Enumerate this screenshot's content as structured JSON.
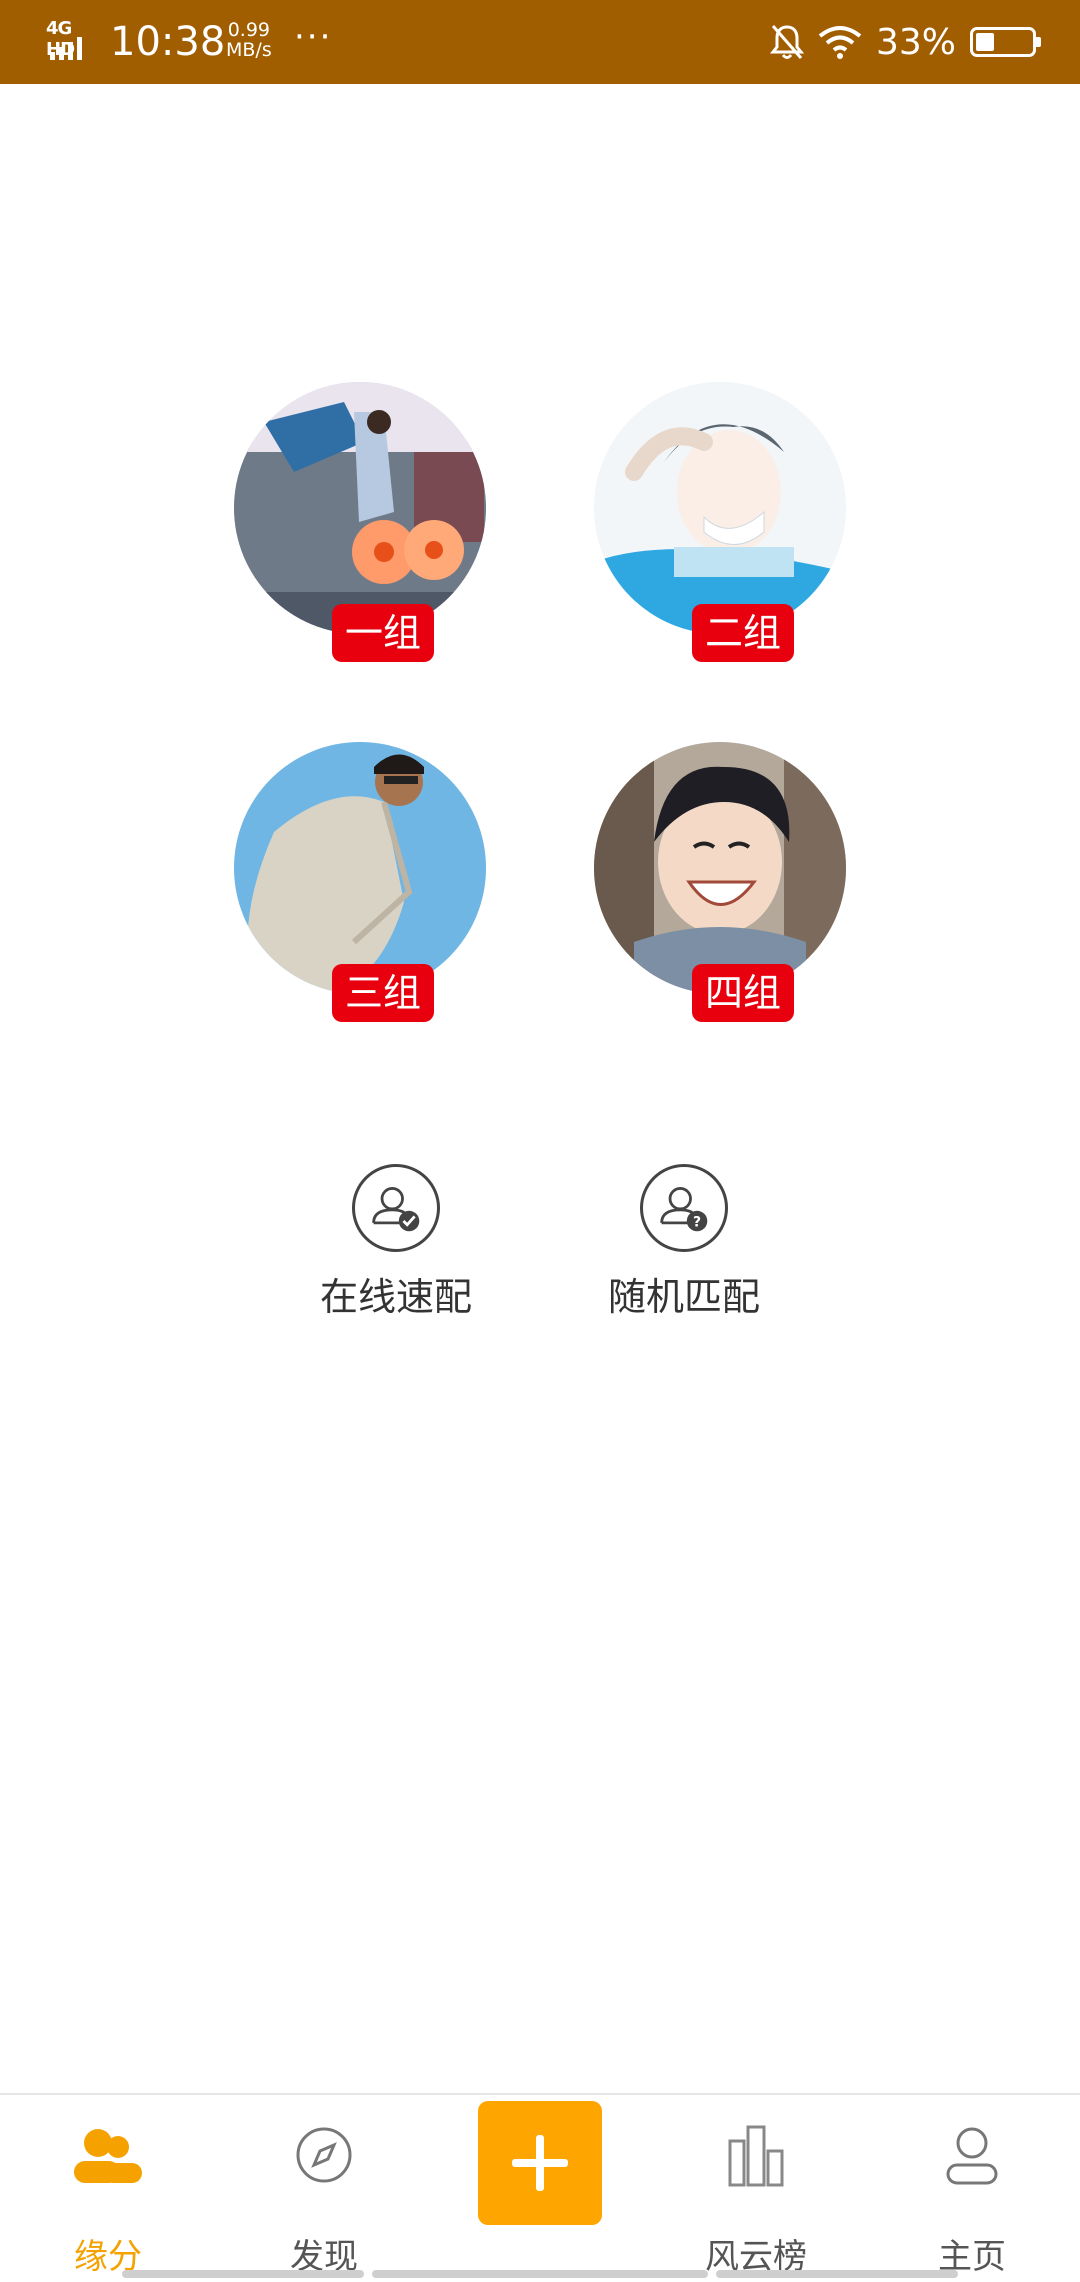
{
  "status_bar": {
    "network": "4G HD",
    "time": "10:38",
    "speed_value": "0.99",
    "speed_unit": "MB/s",
    "more": "···",
    "battery_percent": "33%",
    "battery_level": 0.33,
    "icons": [
      "bell-off-icon",
      "wifi-icon",
      "battery-icon"
    ]
  },
  "groups": [
    {
      "label": "一组",
      "avatar": "avatar-photo-girl-on-boat"
    },
    {
      "label": "二组",
      "avatar": "avatar-anime-boy"
    },
    {
      "label": "三组",
      "avatar": "avatar-photo-man-jacket"
    },
    {
      "label": "四组",
      "avatar": "avatar-photo-boy-smiling"
    }
  ],
  "actions": [
    {
      "label": "在线速配",
      "icon": "user-check-icon"
    },
    {
      "label": "随机匹配",
      "icon": "user-question-icon"
    }
  ],
  "bottom_nav": {
    "items": [
      {
        "label": "缘分",
        "icon": "users-icon",
        "active": true
      },
      {
        "label": "发现",
        "icon": "compass-icon",
        "active": false
      },
      {
        "label": "风云榜",
        "icon": "ranking-icon",
        "active": false
      },
      {
        "label": "主页",
        "icon": "profile-icon",
        "active": false
      }
    ],
    "center_button_icon": "plus-icon"
  },
  "colors": {
    "status_bar": "#A15E00",
    "accent": "#F5A200",
    "tag_red": "#E8000F"
  }
}
